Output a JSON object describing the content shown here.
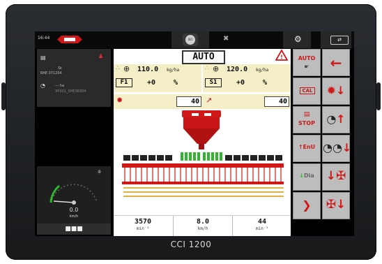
{
  "colors": {
    "accent_red": "#d01818",
    "panel_yellow": "#f4efc7",
    "button_grey": "#bdbdbd",
    "seed_green": "#2fb52f"
  },
  "device": {
    "brand_label": "CCI 1200"
  },
  "topbar": {
    "time": "16:44",
    "logo": "KUHN",
    "iso_label": "ISO",
    "tool_icon": "crossed-tools-icon",
    "settings_icon": "gear-icon",
    "split_icon": "split-screen-icon"
  },
  "left_panel": {
    "line1": "Sk",
    "line2": "BAE 071204",
    "line3": "--- ha",
    "line4": "XP301_SHE38304",
    "speed_value": "0.0",
    "speed_unit": "km/h",
    "menu_label": "■■■"
  },
  "main": {
    "mode_label": "AUTO",
    "rate1": {
      "value": "110.0",
      "unit": "kg/ha",
      "tag": "F1",
      "offset": "+0",
      "percent": "%"
    },
    "rate2": {
      "value": "120.0",
      "unit": "kg/ha",
      "tag": "S1",
      "offset": "+0",
      "percent": "%"
    },
    "metering1_value": "40",
    "metering2_value": "40",
    "stats": [
      {
        "value": "3570",
        "unit": "min⁻¹"
      },
      {
        "value": "8.0",
        "unit": "km/h"
      },
      {
        "value": "44",
        "unit": "min⁻¹"
      }
    ]
  },
  "buttons": {
    "auto_toggle": "AUTO",
    "back": "←",
    "calibration": "CAL",
    "stop": "STOP",
    "endu": "EnU",
    "dia": "Dia"
  }
}
